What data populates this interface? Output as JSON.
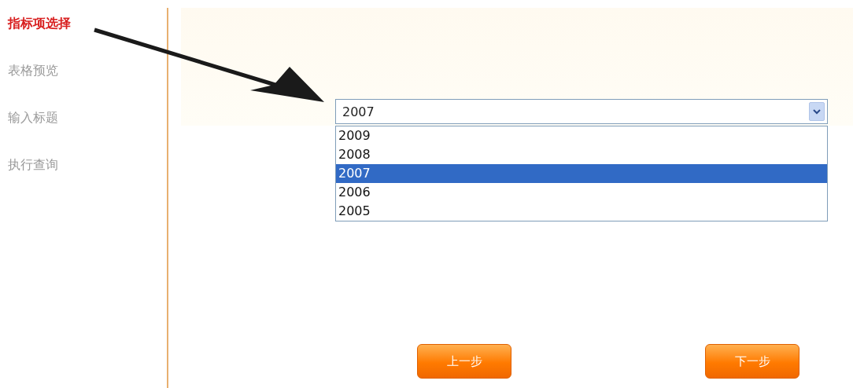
{
  "steps": [
    {
      "label": "指标项选择",
      "selected": true
    },
    {
      "label": "表格预览",
      "selected": false
    },
    {
      "label": "输入标题",
      "selected": false
    },
    {
      "label": "执行查询",
      "selected": false
    }
  ],
  "year_select": {
    "value": "2007",
    "expanded": true,
    "options": [
      {
        "label": "2009",
        "selected": false
      },
      {
        "label": "2008",
        "selected": false
      },
      {
        "label": "2007",
        "selected": true
      },
      {
        "label": "2006",
        "selected": false
      },
      {
        "label": "2005",
        "selected": false
      }
    ]
  },
  "buttons": [
    {
      "label": "上一步"
    },
    {
      "label": "下一步"
    }
  ]
}
